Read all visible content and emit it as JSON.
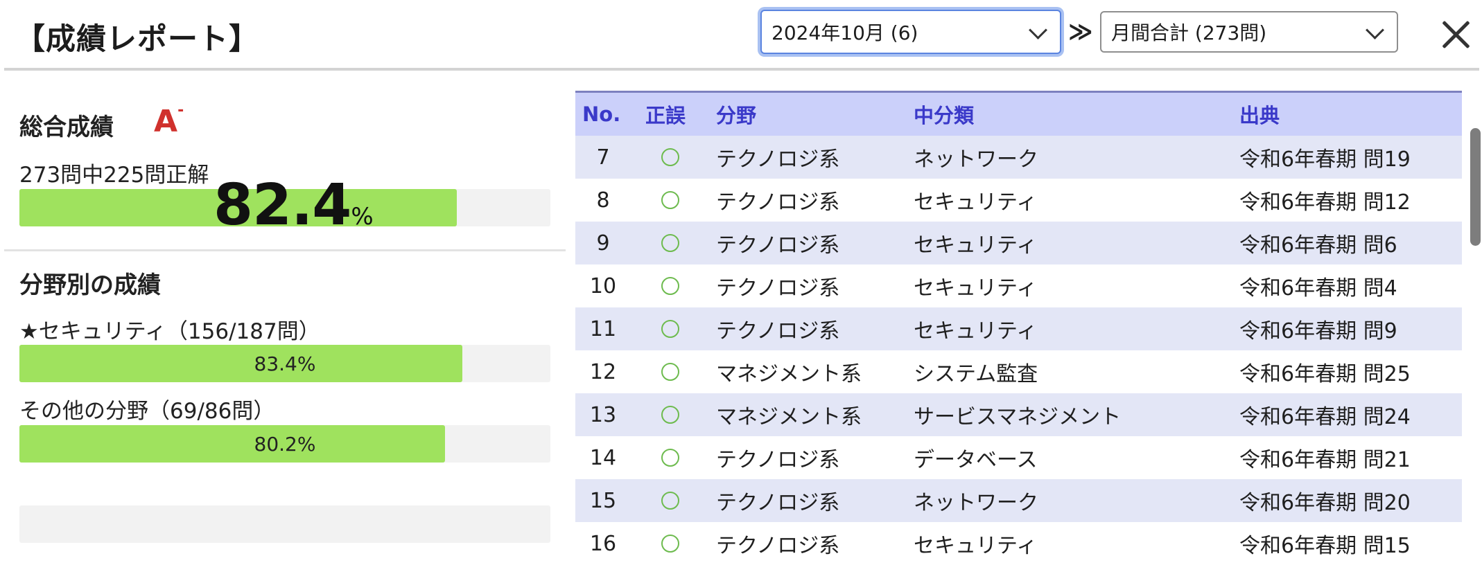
{
  "header": {
    "title": "【成績レポート】",
    "month_select": "2024年10月 (6)",
    "double_chevron": "≫",
    "scope_select": "月間合計 (273問)"
  },
  "overall": {
    "heading": "総合成績",
    "grade": "A",
    "grade_suffix": "-",
    "summary": "273問中225問正解",
    "percent": "82.4",
    "percent_unit": "%",
    "percent_value": 82.4
  },
  "fields": {
    "heading": "分野別の成績",
    "items": [
      {
        "label": "★セキュリティ（156/187問）",
        "percent_text": "83.4%",
        "percent_value": 83.4
      },
      {
        "label": "その他の分野（69/86問）",
        "percent_text": "80.2%",
        "percent_value": 80.2
      }
    ]
  },
  "table": {
    "columns": [
      "No.",
      "正誤",
      "分野",
      "中分類",
      "出典"
    ],
    "rows": [
      {
        "no": "7",
        "field": "テクノロジ系",
        "category": "ネットワーク",
        "source": "令和6年春期 問19",
        "correct": true
      },
      {
        "no": "8",
        "field": "テクノロジ系",
        "category": "セキュリティ",
        "source": "令和6年春期 問12",
        "correct": true
      },
      {
        "no": "9",
        "field": "テクノロジ系",
        "category": "セキュリティ",
        "source": "令和6年春期 問6",
        "correct": true
      },
      {
        "no": "10",
        "field": "テクノロジ系",
        "category": "セキュリティ",
        "source": "令和6年春期 問4",
        "correct": true
      },
      {
        "no": "11",
        "field": "テクノロジ系",
        "category": "セキュリティ",
        "source": "令和6年春期 問9",
        "correct": true
      },
      {
        "no": "12",
        "field": "マネジメント系",
        "category": "システム監査",
        "source": "令和6年春期 問25",
        "correct": true
      },
      {
        "no": "13",
        "field": "マネジメント系",
        "category": "サービスマネジメント",
        "source": "令和6年春期 問24",
        "correct": true
      },
      {
        "no": "14",
        "field": "テクノロジ系",
        "category": "データベース",
        "source": "令和6年春期 問21",
        "correct": true
      },
      {
        "no": "15",
        "field": "テクノロジ系",
        "category": "ネットワーク",
        "source": "令和6年春期 問20",
        "correct": true
      },
      {
        "no": "16",
        "field": "テクノロジ系",
        "category": "セキュリティ",
        "source": "令和6年春期 問15",
        "correct": true
      }
    ]
  },
  "colors": {
    "bar_fill": "#9fe25e",
    "grade_red": "#d0312d",
    "table_header_bg": "#cbd0fa",
    "table_header_text": "#3a39c9",
    "row_alt_bg": "#e3e6f6",
    "correct_circle": "#6dbb4e"
  }
}
